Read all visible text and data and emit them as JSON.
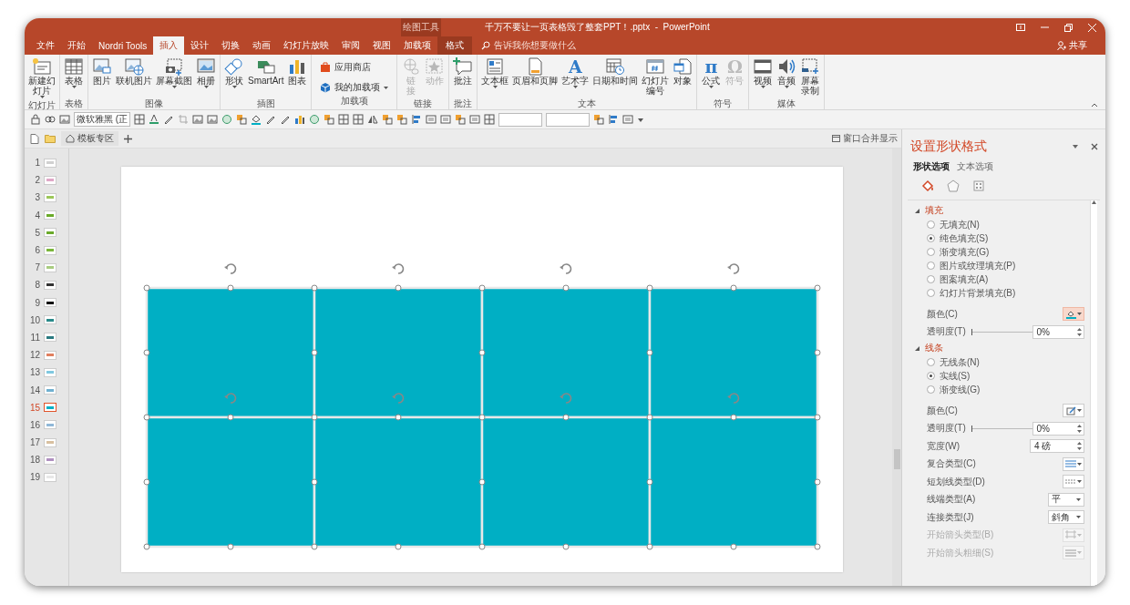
{
  "title_bar": {
    "context_label": "绘图工具",
    "title": "千万不要让一页表格毁了整套PPT！.pptx  -  PowerPoint"
  },
  "tabs": [
    {
      "label": "文件",
      "selected": false,
      "kind": "normal"
    },
    {
      "label": "开始",
      "selected": false,
      "kind": "normal"
    },
    {
      "label": "Nordri Tools",
      "selected": false,
      "kind": "normal"
    },
    {
      "label": "插入",
      "selected": true,
      "kind": "normal"
    },
    {
      "label": "设计",
      "selected": false,
      "kind": "normal"
    },
    {
      "label": "切换",
      "selected": false,
      "kind": "normal"
    },
    {
      "label": "动画",
      "selected": false,
      "kind": "normal"
    },
    {
      "label": "幻灯片放映",
      "selected": false,
      "kind": "normal"
    },
    {
      "label": "审阅",
      "selected": false,
      "kind": "normal"
    },
    {
      "label": "视图",
      "selected": false,
      "kind": "normal"
    },
    {
      "label": "加载项",
      "selected": false,
      "kind": "normal"
    },
    {
      "label": "格式",
      "selected": false,
      "kind": "context"
    }
  ],
  "search": {
    "placeholder": "告诉我你想要做什么"
  },
  "share_button": "共享",
  "ribbon": [
    {
      "label": "幻灯片",
      "kind": "large",
      "buttons": [
        {
          "label": "新建幻灯片",
          "kind": "stacked",
          "menu": true,
          "disabled": false
        }
      ]
    },
    {
      "label": "表格",
      "kind": "large",
      "buttons": [
        {
          "label": "表格",
          "menu": true,
          "disabled": false
        }
      ]
    },
    {
      "label": "图像",
      "kind": "large",
      "buttons": [
        {
          "label": "图片",
          "menu": false,
          "disabled": false
        },
        {
          "label": "联机图片",
          "menu": false,
          "disabled": false
        },
        {
          "label": "屏幕截图",
          "menu": true,
          "disabled": false
        },
        {
          "label": "相册",
          "menu": true,
          "disabled": false
        }
      ]
    },
    {
      "label": "插图",
      "kind": "large",
      "buttons": [
        {
          "label": "形状",
          "menu": true,
          "disabled": false
        },
        {
          "label": "SmartArt",
          "menu": false,
          "disabled": false
        },
        {
          "label": "图表",
          "menu": false,
          "disabled": false
        }
      ]
    },
    {
      "label": "加载项",
      "kind": "small",
      "buttons": [
        {
          "label": "应用商店",
          "menu": false,
          "disabled": false
        },
        {
          "label": "我的加载项",
          "menu": true,
          "disabled": false
        }
      ]
    },
    {
      "label": "链接",
      "kind": "large",
      "buttons": [
        {
          "label": "链接",
          "kind": "stacked",
          "menu": false,
          "disabled": true
        },
        {
          "label": "动作",
          "menu": false,
          "disabled": true
        }
      ]
    },
    {
      "label": "批注",
      "kind": "large",
      "buttons": [
        {
          "label": "批注",
          "menu": false,
          "disabled": false
        }
      ]
    },
    {
      "label": "文本",
      "kind": "large",
      "buttons": [
        {
          "label": "文本框",
          "menu": true,
          "disabled": false
        },
        {
          "label": "页眉和页脚",
          "menu": false,
          "disabled": false
        },
        {
          "label": "艺术字",
          "menu": true,
          "disabled": false,
          "glyph": "A"
        },
        {
          "label": "日期和时间",
          "menu": false,
          "disabled": false
        },
        {
          "label": "幻灯片编号",
          "kind": "stacked",
          "menu": false,
          "disabled": false
        },
        {
          "label": "对象",
          "menu": false,
          "disabled": false
        }
      ]
    },
    {
      "label": "符号",
      "kind": "large",
      "buttons": [
        {
          "label": "公式",
          "menu": true,
          "disabled": false,
          "glyph": "π"
        },
        {
          "label": "符号",
          "menu": false,
          "disabled": true,
          "glyph": "Ω"
        }
      ]
    },
    {
      "label": "媒体",
      "kind": "large",
      "buttons": [
        {
          "label": "视频",
          "menu": true,
          "disabled": false
        },
        {
          "label": "音频",
          "menu": true,
          "disabled": false
        },
        {
          "label": "屏幕录制",
          "kind": "stacked",
          "menu": false,
          "disabled": false
        }
      ]
    }
  ],
  "format_toolbar": {
    "font": "微软雅黑 (正"
  },
  "doc_tabs": [
    {
      "label": "模板专区"
    }
  ],
  "merge_windows": "窗口合并显示",
  "slides": [
    {
      "number": "1",
      "selected": false,
      "color": "#d0d0d0"
    },
    {
      "number": "2",
      "selected": false,
      "color": "#e0a8c8"
    },
    {
      "number": "3",
      "selected": false,
      "color": "#9cc75a"
    },
    {
      "number": "4",
      "selected": false,
      "color": "#6aaa2a"
    },
    {
      "number": "5",
      "selected": false,
      "color": "#6aaa2a"
    },
    {
      "number": "6",
      "selected": false,
      "color": "#7ab63a"
    },
    {
      "number": "7",
      "selected": false,
      "color": "#a8cc80"
    },
    {
      "number": "8",
      "selected": false,
      "color": "#333333"
    },
    {
      "number": "9",
      "selected": false,
      "color": "#111111"
    },
    {
      "number": "10",
      "selected": false,
      "color": "#2a8a8a"
    },
    {
      "number": "11",
      "selected": false,
      "color": "#2a7a80"
    },
    {
      "number": "12",
      "selected": false,
      "color": "#e08060"
    },
    {
      "number": "13",
      "selected": false,
      "color": "#80c8e0"
    },
    {
      "number": "14",
      "selected": false,
      "color": "#70b0d0"
    },
    {
      "number": "15",
      "selected": true,
      "color": "#00afc4"
    },
    {
      "number": "16",
      "selected": false,
      "color": "#90b8d8"
    },
    {
      "number": "17",
      "selected": false,
      "color": "#d8c0a0"
    },
    {
      "number": "18",
      "selected": false,
      "color": "#b090c0"
    },
    {
      "number": "19",
      "selected": false,
      "color": "#e8e8e8"
    }
  ],
  "canvas": {
    "shapes": [
      {
        "selected": true
      },
      {
        "selected": true
      },
      {
        "selected": true
      },
      {
        "selected": true
      },
      {
        "selected": true
      },
      {
        "selected": true
      },
      {
        "selected": true
      },
      {
        "selected": true
      }
    ]
  },
  "format_pane": {
    "title": "设置形状格式",
    "tabs": [
      {
        "label": "形状选项",
        "selected": true
      },
      {
        "label": "文本选项",
        "selected": false
      }
    ],
    "icon_tabs": [
      {
        "selected": true
      },
      {
        "selected": false
      },
      {
        "selected": false
      }
    ],
    "sections": [
      {
        "label": "填充",
        "expanded": true,
        "options": [
          {
            "label": "无填充(N)",
            "selected": false
          },
          {
            "label": "纯色填充(S)",
            "selected": true
          },
          {
            "label": "渐变填充(G)",
            "selected": false
          },
          {
            "label": "图片或纹理填充(P)",
            "selected": false
          },
          {
            "label": "图案填充(A)",
            "selected": false
          },
          {
            "label": "幻灯片背景填充(B)",
            "selected": false
          }
        ],
        "rows": [
          {
            "kind": "color",
            "label": "颜色(C)",
            "highlighted": true,
            "disabled": false
          },
          {
            "kind": "slider",
            "label": "透明度(T)",
            "value": "0%",
            "level": 0,
            "disabled": false
          }
        ]
      },
      {
        "label": "线条",
        "expanded": true,
        "options": [
          {
            "label": "无线条(N)",
            "selected": false
          },
          {
            "label": "实线(S)",
            "selected": true
          },
          {
            "label": "渐变线(G)",
            "selected": false
          }
        ],
        "rows": [
          {
            "kind": "color",
            "label": "颜色(C)",
            "highlighted": false,
            "disabled": false
          },
          {
            "kind": "slider",
            "label": "透明度(T)",
            "value": "0%",
            "level": 0,
            "disabled": false
          },
          {
            "kind": "spin",
            "label": "宽度(W)",
            "value": "4 磅",
            "disabled": false
          },
          {
            "kind": "compound",
            "label": "复合类型(C)",
            "disabled": false
          },
          {
            "kind": "dash",
            "label": "短划线类型(D)",
            "disabled": false
          },
          {
            "kind": "select",
            "label": "线端类型(A)",
            "value": "平",
            "disabled": false
          },
          {
            "kind": "select",
            "label": "连接类型(J)",
            "value": "斜角",
            "disabled": false
          },
          {
            "kind": "arrow",
            "label": "开始箭头类型(B)",
            "disabled": true
          },
          {
            "kind": "weight",
            "label": "开始箭头粗细(S)",
            "disabled": true
          }
        ]
      }
    ]
  }
}
